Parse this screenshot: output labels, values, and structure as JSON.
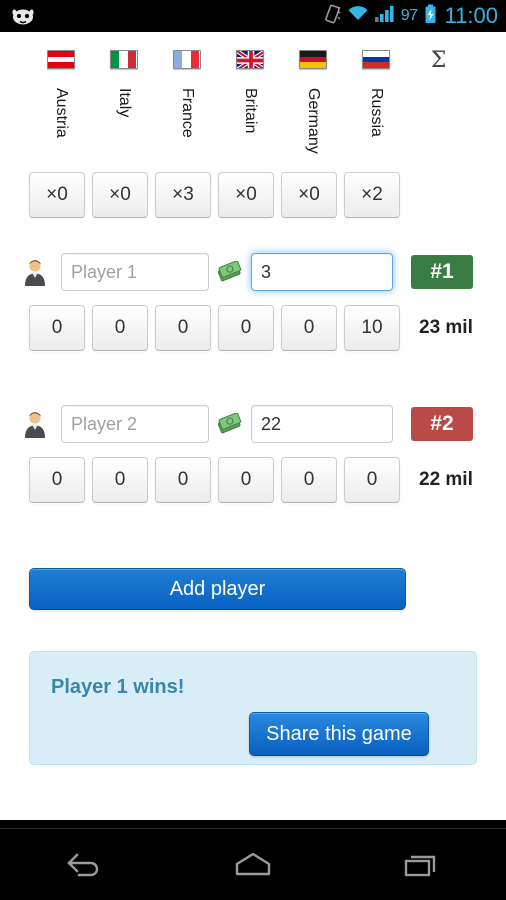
{
  "statusbar": {
    "logo_icon": "cyanogenmod-logo-icon",
    "vibrate_icon": "vibrate-icon",
    "wifi_icon": "wifi-icon",
    "signal_icon": "signal-bars-icon",
    "battery_percent": "97",
    "battery_icon": "battery-charging-icon",
    "clock": "11:00",
    "accent_color": "#33b5e5"
  },
  "columns": [
    {
      "flag": "flag-austria-icon",
      "name": "Austria",
      "multiplier": "×0"
    },
    {
      "flag": "flag-italy-icon",
      "name": "Italy",
      "multiplier": "×0"
    },
    {
      "flag": "flag-france-icon",
      "name": "France",
      "multiplier": "×3"
    },
    {
      "flag": "flag-britain-icon",
      "name": "Britain",
      "multiplier": "×0"
    },
    {
      "flag": "flag-germany-icon",
      "name": "Germany",
      "multiplier": "×0"
    },
    {
      "flag": "flag-russia-icon",
      "name": "Russia",
      "multiplier": "×2"
    }
  ],
  "total_column": {
    "symbol": "Σ",
    "icon": "sigma-total-icon"
  },
  "players": [
    {
      "avatar_icon": "player-avatar-icon",
      "name_value": "",
      "name_placeholder": "Player 1",
      "money_icon": "money-banknotes-icon",
      "money_value": "3",
      "money_focused": true,
      "rank": "#1",
      "rank_color": "#3a7d44",
      "scores": [
        "0",
        "0",
        "0",
        "0",
        "0",
        "10"
      ],
      "total": "23 mil"
    },
    {
      "avatar_icon": "player-avatar-icon",
      "name_value": "",
      "name_placeholder": "Player 2",
      "money_icon": "money-banknotes-icon",
      "money_value": "22",
      "money_focused": false,
      "rank": "#2",
      "rank_color": "#b94a48",
      "scores": [
        "0",
        "0",
        "0",
        "0",
        "0",
        "0"
      ],
      "total": "22 mil"
    }
  ],
  "add_player_button": {
    "label": "Add player",
    "color": "#0a61c4"
  },
  "result_alert": {
    "message": "Player 1 wins!",
    "text_color": "#3a87ad",
    "background": "#d9edf7",
    "share_button_label": "Share this game"
  },
  "navbar": {
    "back_icon": "back-arrow-icon",
    "home_icon": "home-icon",
    "recents_icon": "recent-apps-icon"
  }
}
